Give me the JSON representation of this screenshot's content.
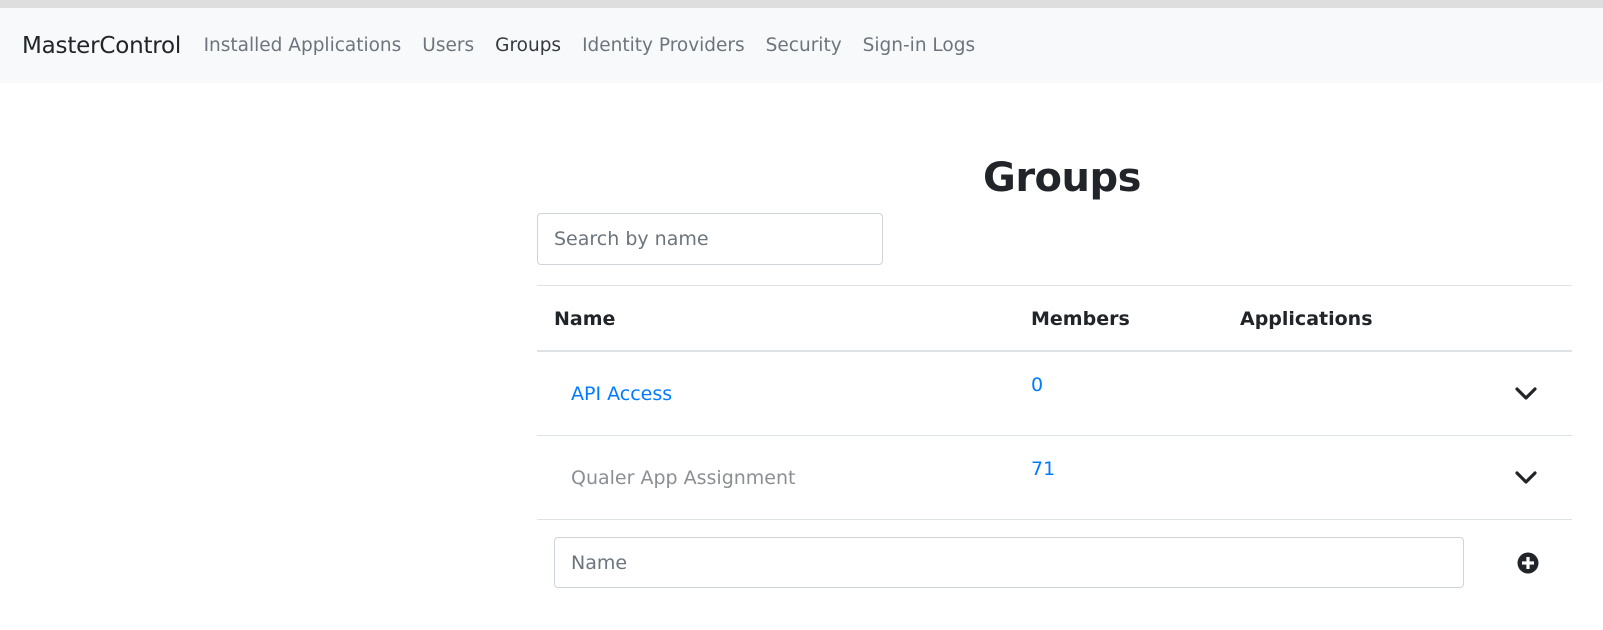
{
  "app": {
    "brand": "MasterControl"
  },
  "nav": {
    "items": [
      {
        "label": "Installed Applications",
        "active": false
      },
      {
        "label": "Users",
        "active": false
      },
      {
        "label": "Groups",
        "active": true
      },
      {
        "label": "Identity Providers",
        "active": false
      },
      {
        "label": "Security",
        "active": false
      },
      {
        "label": "Sign-in Logs",
        "active": false
      }
    ]
  },
  "page": {
    "title": "Groups"
  },
  "search": {
    "placeholder": "Search by name",
    "value": ""
  },
  "table": {
    "columns": [
      "Name",
      "Members",
      "Applications"
    ],
    "rows": [
      {
        "name": "API Access",
        "members": "0",
        "applications": "",
        "style": "link",
        "expand_icon": "chevron-down-icon"
      },
      {
        "name": "Qualer App Assignment",
        "members": "71",
        "applications": "",
        "style": "muted",
        "expand_icon": "chevron-down-icon"
      }
    ]
  },
  "add_group": {
    "placeholder": "Name",
    "value": "",
    "button_icon": "plus-circle-icon"
  },
  "colors": {
    "link": "#007bff",
    "navbar_bg": "#f8f9fa",
    "muted_text": "#6c757d"
  }
}
